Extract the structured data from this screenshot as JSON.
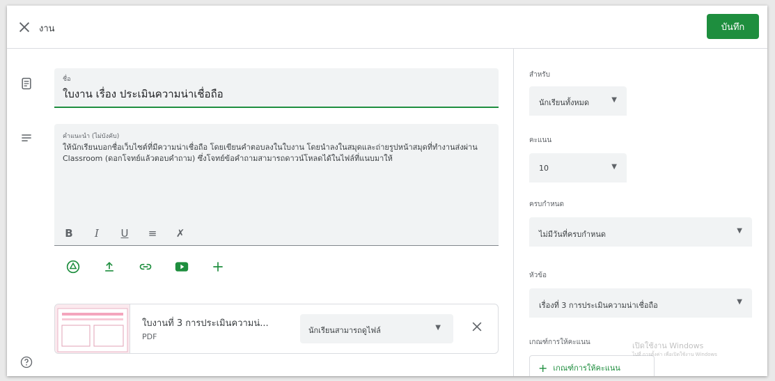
{
  "header": {
    "title": "งาน",
    "save_label": "บันทึก",
    "close_icon": "close-icon"
  },
  "form": {
    "title_label": "ชื่อ",
    "title_value": "ใบงาน เรื่อง ประเมินความน่าเชื่อถือ",
    "desc_label": "คำแนะนำ (ไม่บังคับ)",
    "desc_value": "ให้นักเรียนบอกชื่อเว็บไซต์ที่มีความน่าเชื่อถือ โดยเขียนคำตอบลงในใบงาน โดยนำลงในสมุดและถ่ายรูปหน้าสมุดที่ทำงานส่งผ่าน Classroom (ดอกโจทย์แล้วตอบคำถาม) ซึ่งโจทย์ข้อคำถามสามารถดาวน์โหลดได้ในไฟล์ที่แนบมาให้",
    "format_buttons": [
      "B",
      "I",
      "U",
      "≡",
      "✗"
    ],
    "attach_icons": [
      "drive-icon",
      "upload-icon",
      "link-icon",
      "youtube-icon",
      "plus-icon"
    ]
  },
  "attachment": {
    "name": "ใบงานที่ 3 การประเมินความน่...",
    "type": "PDF",
    "permission": "นักเรียนสามารถดูไฟล์"
  },
  "sidebar": {
    "for_label": "สำหรับ",
    "for_value": "นักเรียนทั้งหมด",
    "points_label": "คะแนน",
    "points_value": "10",
    "due_label": "ครบกำหนด",
    "due_value": "ไม่มีวันที่ครบกำหนด",
    "topic_label": "หัวข้อ",
    "topic_value": "เรื่องที่ 3 การประเมินความน่าเชื่อถือ",
    "rubric_label": "เกณฑ์การให้คะแนน",
    "rubric_button": "เกณฑ์การให้คะแนน"
  },
  "watermark": {
    "line1": "เปิดใช้งาน Windows",
    "line2": "ไปที่ การตั้งค่า เพื่อเปิดใช้งาน Windows"
  },
  "colors": {
    "accent": "#1e8e3e",
    "field_bg": "#f1f3f4",
    "youtube": "#1e8e3e"
  }
}
